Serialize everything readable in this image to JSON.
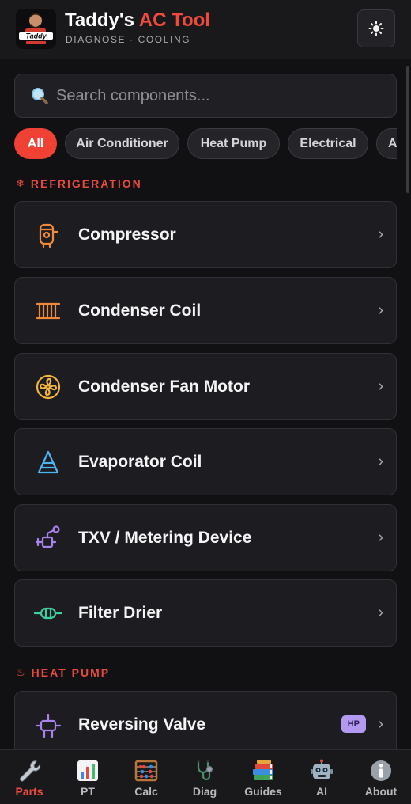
{
  "header": {
    "title_main": "Taddy's",
    "title_accent": "AC Tool",
    "subtitle": "DIAGNOSE · COOLING",
    "logo_text": "Taddy",
    "theme_icon": "sun-icon"
  },
  "search": {
    "placeholder": "Search components...",
    "icon": "search-icon"
  },
  "filters": [
    "All",
    "Air Conditioner",
    "Heat Pump",
    "Electrical",
    "A"
  ],
  "sections": {
    "refrigeration": {
      "symbol": "❄",
      "label": "REFRIGERATION"
    },
    "heat_pump": {
      "symbol": "♨",
      "label": "HEAT PUMP"
    }
  },
  "components": [
    {
      "label": "Compressor",
      "icon": "compressor-icon",
      "color": "#f08a3a"
    },
    {
      "label": "Condenser Coil",
      "icon": "condenser-coil-icon",
      "color": "#f08a3a"
    },
    {
      "label": "Condenser Fan Motor",
      "icon": "fan-icon",
      "color": "#f2b43c"
    },
    {
      "label": "Evaporator Coil",
      "icon": "evaporator-coil-icon",
      "color": "#4fb4ef"
    },
    {
      "label": "TXV / Metering Device",
      "icon": "txv-icon",
      "color": "#a982f0"
    },
    {
      "label": "Filter Drier",
      "icon": "filter-drier-icon",
      "color": "#3ecf9b"
    },
    {
      "label": "Reversing Valve",
      "icon": "reversing-valve-icon",
      "color": "#a982f0",
      "badge": "HP"
    }
  ],
  "chevron": "›",
  "tabs": [
    {
      "label": "Parts",
      "icon": "wrench-icon",
      "active": true
    },
    {
      "label": "PT",
      "icon": "chart-icon"
    },
    {
      "label": "Calc",
      "icon": "abacus-icon"
    },
    {
      "label": "Diag",
      "icon": "stethoscope-icon"
    },
    {
      "label": "Guides",
      "icon": "books-icon"
    },
    {
      "label": "AI",
      "icon": "robot-icon"
    },
    {
      "label": "About",
      "icon": "info-icon"
    }
  ],
  "colors": {
    "accent": "#ef4234",
    "background": "#111113",
    "card": "#1d1d21",
    "badge": "#b39af0"
  }
}
